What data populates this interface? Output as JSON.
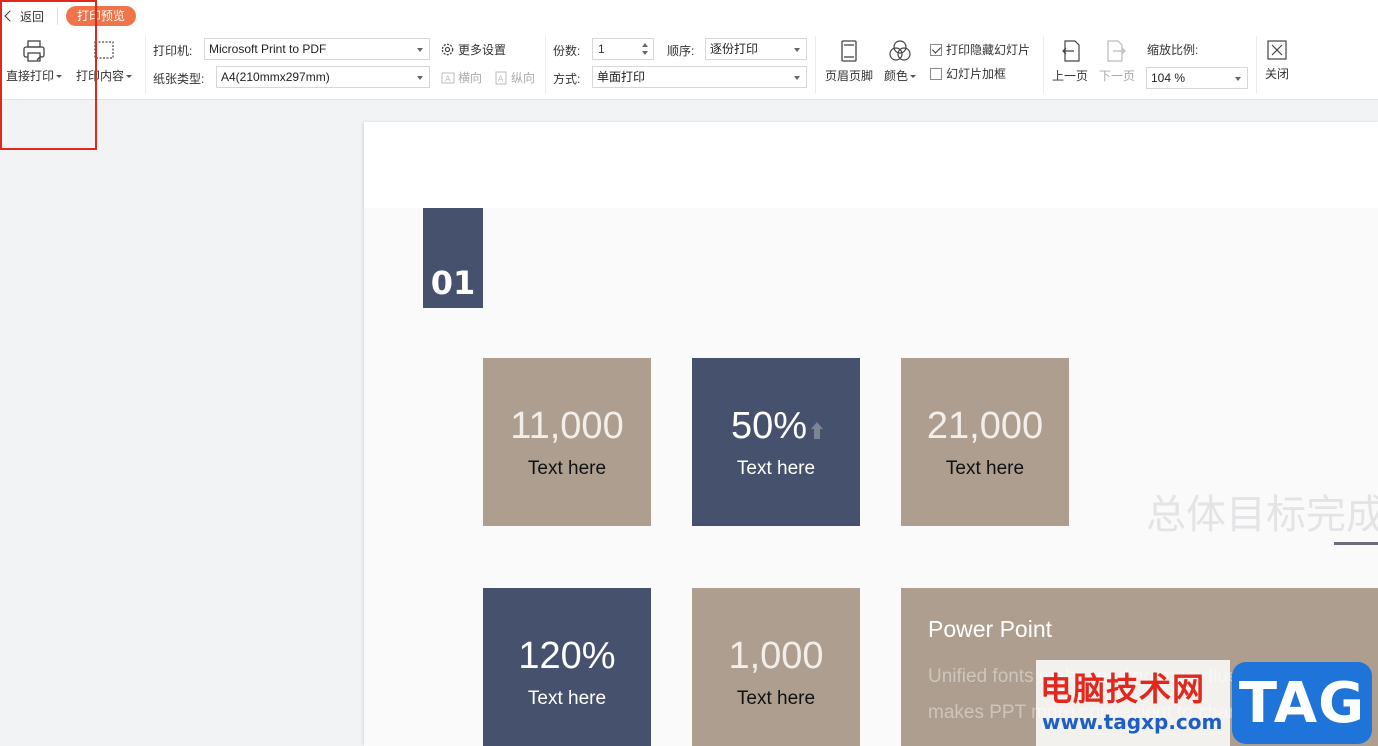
{
  "header": {
    "back_label": "返回",
    "badge_label": "打印预览"
  },
  "toolbar": {
    "direct_print": "直接打印",
    "print_content": "打印内容",
    "printer_label": "打印机:",
    "printer_value": "Microsoft Print to PDF",
    "paper_label": "纸张类型:",
    "paper_value": "A4(210mmx297mm)",
    "more_settings": "更多设置",
    "landscape": "横向",
    "portrait": "纵向",
    "copies_label": "份数:",
    "copies_value": "1",
    "order_label": "顺序:",
    "order_value": "逐份打印",
    "mode_label": "方式:",
    "mode_value": "单面打印",
    "header_footer": "页眉页脚",
    "color": "颜色",
    "print_hidden_slides": "打印隐藏幻灯片",
    "print_hidden_checked": true,
    "slide_frame": "幻灯片加框",
    "slide_frame_checked": false,
    "prev_page": "上一页",
    "next_page": "下一页",
    "zoom_label": "缩放比例:",
    "zoom_value": "104 %",
    "close": "关闭"
  },
  "slide": {
    "section_number": "01",
    "tiles": [
      {
        "value": "11,000",
        "text": "Text here",
        "style": "tan"
      },
      {
        "value": "50%",
        "text": "Text here",
        "style": "navy",
        "arrow": "up-arrow-icon"
      },
      {
        "value": "21,000",
        "text": "Text here",
        "style": "tan"
      },
      {
        "value": "120%",
        "text": "Text here",
        "style": "navy"
      },
      {
        "value": "1,000",
        "text": "Text here",
        "style": "tan"
      }
    ],
    "faded_title": "总体目标完成",
    "wide_tile_title": "Power Point",
    "wide_tile_body": "Unified fonts make reading more fluent. Theme makes PPT more convenient to change."
  },
  "watermark": {
    "cn": "电脑技术网",
    "url": "www.tagxp.com",
    "tag": "TAG"
  },
  "colors": {
    "accent": "#f0734a",
    "tan": "#ad9e8f",
    "navy": "#45516d",
    "highlight": "#e0281f"
  }
}
